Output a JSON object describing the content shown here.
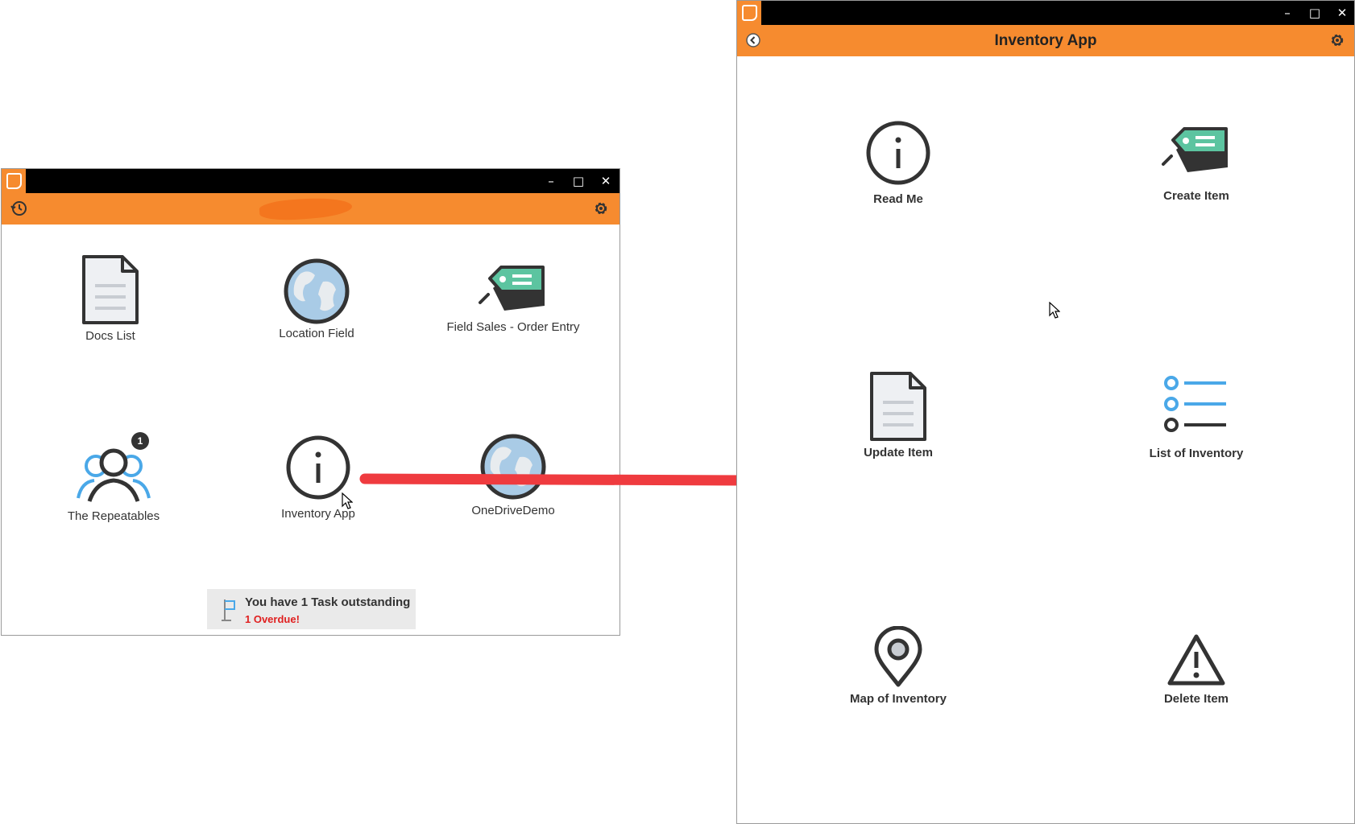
{
  "colors": {
    "accent": "#f68b2f",
    "titlebar": "#000000",
    "teal": "#5cc4a0",
    "blue": "#4aa8e8",
    "overdue": "#e02020",
    "arrow": "#ef3b3f"
  },
  "window_controls": {
    "minimize": "–",
    "maximize": "□",
    "close": "✕"
  },
  "home_window": {
    "header_icons": {
      "left": "history-icon",
      "right": "gear-icon"
    },
    "apps": [
      {
        "label": "Docs List",
        "icon": "document-icon"
      },
      {
        "label": "Location Field",
        "icon": "globe-icon"
      },
      {
        "label": "Field Sales - Order Entry",
        "icon": "tag-icon"
      },
      {
        "label": "The Repeatables",
        "icon": "users-icon",
        "badge": "1"
      },
      {
        "label": "Inventory App",
        "icon": "info-icon"
      },
      {
        "label": "OneDriveDemo",
        "icon": "globe-icon"
      }
    ],
    "task_banner": {
      "message": "You have 1 Task outstanding",
      "overdue": "1 Overdue!",
      "icon": "flag-icon"
    }
  },
  "inventory_window": {
    "title": "Inventory App",
    "header_icons": {
      "left": "back-icon",
      "right": "gear-icon"
    },
    "items": [
      {
        "label": "Read Me",
        "icon": "info-icon"
      },
      {
        "label": "Create Item",
        "icon": "tag-icon"
      },
      {
        "label": "Update Item",
        "icon": "document-icon"
      },
      {
        "label": "List of Inventory",
        "icon": "list-icon"
      },
      {
        "label": "Map of Inventory",
        "icon": "map-pin-icon"
      },
      {
        "label": "Delete Item",
        "icon": "warning-icon"
      }
    ]
  }
}
